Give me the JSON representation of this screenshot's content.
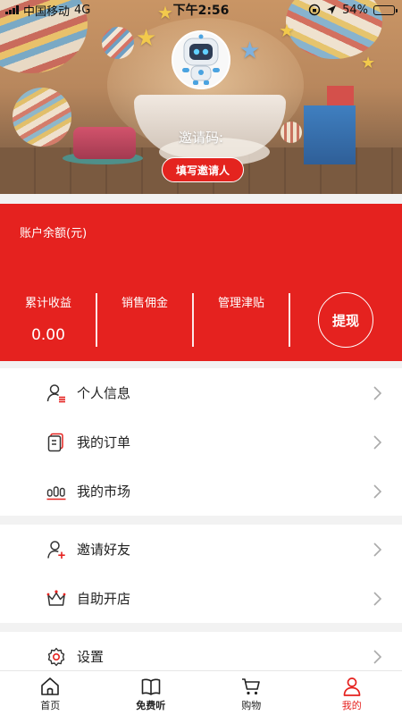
{
  "status_bar": {
    "carrier": "中国移动",
    "network": "4G",
    "time": "下午2:56",
    "battery": "54%",
    "battery_level": 0.54
  },
  "header": {
    "invite_code_label": "邀请码:",
    "invite_button": "填写邀请人"
  },
  "account": {
    "balance_label": "账户余额(元)",
    "stats": [
      {
        "label": "累计收益",
        "value": "0.00"
      },
      {
        "label": "销售佣金",
        "value": ""
      },
      {
        "label": "管理津贴",
        "value": ""
      }
    ],
    "withdraw_button": "提现"
  },
  "menu_groups": [
    {
      "items": [
        {
          "label": "个人信息",
          "icon": "user-profile-icon"
        },
        {
          "label": "我的订单",
          "icon": "order-icon"
        },
        {
          "label": "我的市场",
          "icon": "market-icon"
        }
      ]
    },
    {
      "items": [
        {
          "label": "邀请好友",
          "icon": "add-friend-icon"
        },
        {
          "label": "自助开店",
          "icon": "crown-shop-icon"
        }
      ]
    },
    {
      "items": [
        {
          "label": "设置",
          "icon": "settings-gear-icon"
        }
      ]
    }
  ],
  "tabbar": {
    "tabs": [
      {
        "label": "首页",
        "icon": "home-icon"
      },
      {
        "label": "免费听",
        "icon": "book-icon"
      },
      {
        "label": "购物",
        "icon": "cart-icon"
      },
      {
        "label": "我的",
        "icon": "user-icon",
        "active": true
      }
    ]
  },
  "colors": {
    "accent": "#e5221f",
    "background": "#f2f2f2"
  }
}
